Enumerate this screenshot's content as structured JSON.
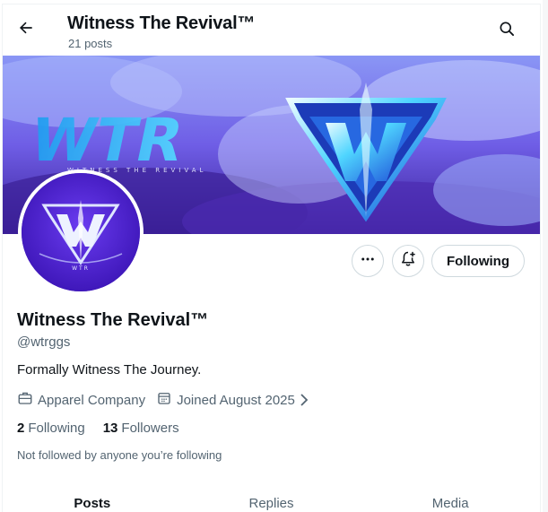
{
  "header": {
    "title": "Witness The Revival™",
    "posts_count": "21 posts"
  },
  "banner": {
    "wordmark": "WTR",
    "tagline": "WITNESS THE REVIVAL",
    "colors": {
      "sky": "#7b7ff2",
      "deep": "#3a1f96",
      "accent": "#4fd5ff"
    }
  },
  "avatar": {
    "monogram": "WTR"
  },
  "actions": {
    "following_label": "Following"
  },
  "profile": {
    "name": "Witness The Revival™",
    "handle": "@wtrggs",
    "bio": "Formally Witness The Journey.",
    "category": "Apparel Company",
    "joined": "Joined August 2025"
  },
  "stats": {
    "following_count": "2",
    "following_label": "Following",
    "followers_count": "13",
    "followers_label": "Followers"
  },
  "followed_by_note": "Not followed by anyone you’re following",
  "tabs": [
    {
      "label": "Posts",
      "active": true
    },
    {
      "label": "Replies",
      "active": false
    },
    {
      "label": "Media",
      "active": false
    }
  ],
  "icons": [
    "back-arrow-icon",
    "search-icon",
    "more-icon",
    "bell-plus-icon",
    "briefcase-icon",
    "calendar-icon",
    "chevron-right-icon"
  ]
}
